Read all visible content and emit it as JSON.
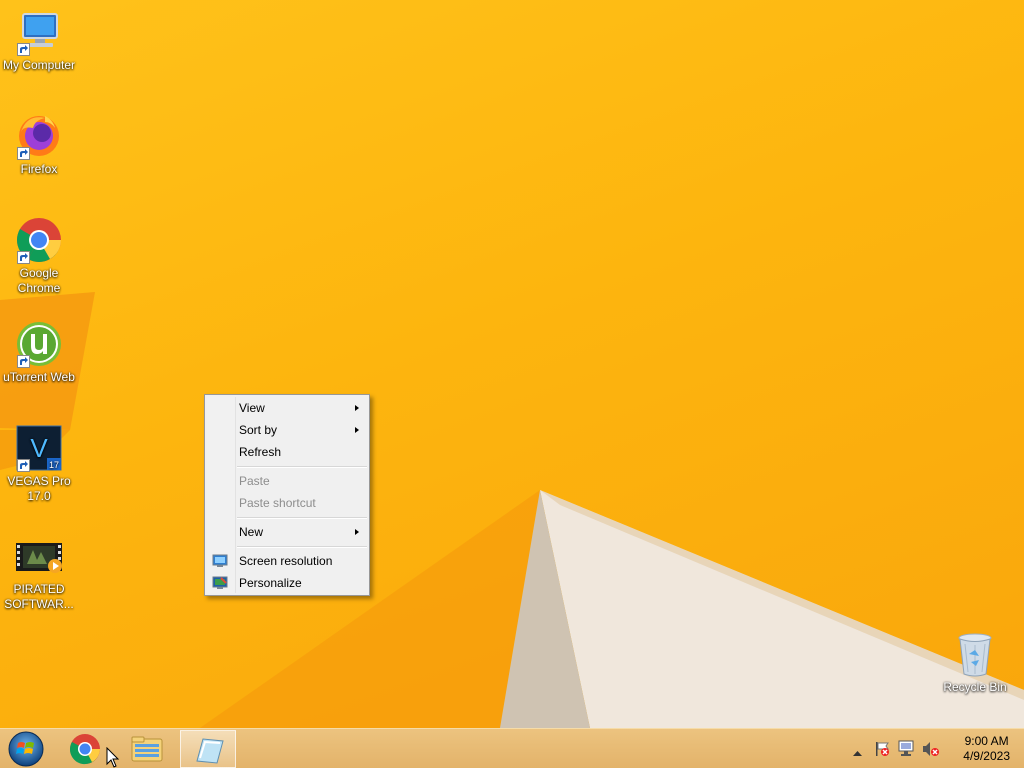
{
  "desktop_icons": [
    {
      "label": "My Computer",
      "icon": "my-computer-icon"
    },
    {
      "label": "Firefox",
      "icon": "firefox-icon"
    },
    {
      "label": "Google Chrome",
      "icon": "chrome-icon"
    },
    {
      "label": "uTorrent Web",
      "icon": "utorrent-icon"
    },
    {
      "label": "VEGAS Pro 17.0",
      "icon": "vegas-pro-icon",
      "badge": "17",
      "letter": "V"
    },
    {
      "label": "PIRATED SOFTWAR...",
      "icon": "video-file-icon"
    },
    {
      "label": "Recycle Bin",
      "icon": "recycle-bin-icon"
    }
  ],
  "context_menu": {
    "items": [
      {
        "label": "View",
        "submenu": true,
        "enabled": true
      },
      {
        "label": "Sort by",
        "submenu": true,
        "enabled": true
      },
      {
        "label": "Refresh",
        "submenu": false,
        "enabled": true
      },
      {
        "label": "Paste",
        "submenu": false,
        "enabled": false
      },
      {
        "label": "Paste shortcut",
        "submenu": false,
        "enabled": false
      },
      {
        "label": "New",
        "submenu": true,
        "enabled": true
      },
      {
        "label": "Screen resolution",
        "submenu": false,
        "enabled": true,
        "icon": "screen-resolution-icon"
      },
      {
        "label": "Personalize",
        "submenu": false,
        "enabled": true,
        "icon": "personalize-icon"
      }
    ]
  },
  "taskbar": {
    "start_icon": "windows-start-icon",
    "pinned": [
      {
        "name": "chrome",
        "icon": "chrome-icon"
      },
      {
        "name": "file-explorer",
        "icon": "file-explorer-icon"
      },
      {
        "name": "active-window",
        "icon": "notepad-icon",
        "active": true
      }
    ],
    "tray_icons": [
      "show-hidden-icons-arrow",
      "action-center-flag-icon",
      "network-icon",
      "volume-muted-icon"
    ],
    "clock": {
      "time": "9:00 AM",
      "date": "4/9/2023"
    }
  },
  "colors": {
    "desktop_bg": "#fdb50e",
    "taskbar_bg": "#e8bc74",
    "menu_bg": "#f0f0f0",
    "menu_disabled_text": "#8d8d8d"
  }
}
